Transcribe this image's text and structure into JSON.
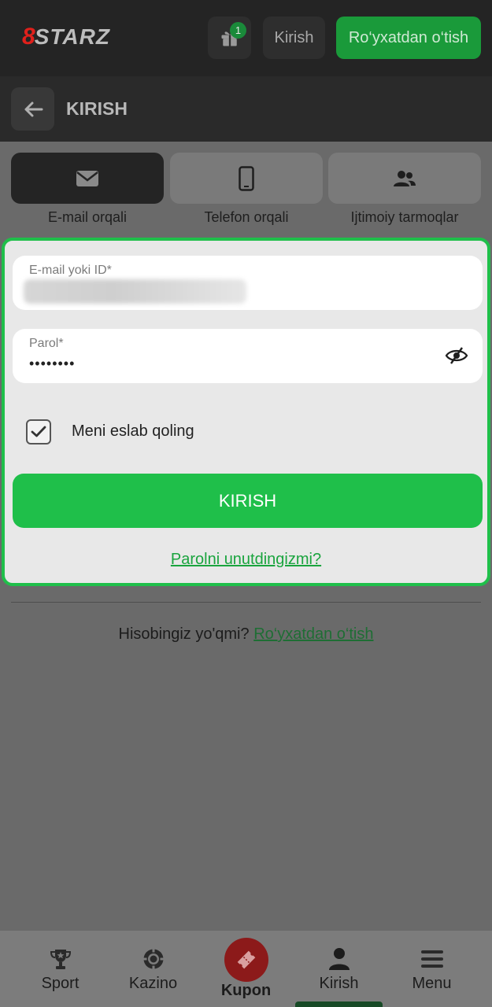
{
  "header": {
    "logo_mark": "8",
    "logo_text": "STARZ",
    "gift_badge": "1",
    "login_label": "Kirish",
    "register_label": "Ro‘yxatdan o‘tish"
  },
  "subheader": {
    "title": "KIRISH"
  },
  "tabs": [
    {
      "label": "E-mail orqali",
      "icon": "envelope-icon",
      "active": true
    },
    {
      "label": "Telefon orqali",
      "icon": "phone-icon",
      "active": false
    },
    {
      "label": "Ijtimoiy tarmoqlar",
      "icon": "people-icon",
      "active": false
    }
  ],
  "form": {
    "email_label": "E-mail yoki ID*",
    "password_label": "Parol*",
    "password_value": "••••••••",
    "remember_label": "Meni eslab qoling",
    "remember_checked": true,
    "submit_label": "KIRISH",
    "forgot_label": "Parolni unutdingizmi?"
  },
  "footer": {
    "no_account_text": "Hisobingiz yo'qmi?",
    "register_link": "Ro‘yxatdan o‘tish"
  },
  "bottom_nav": {
    "sport": "Sport",
    "kazino": "Kazino",
    "kupon": "Kupon",
    "kirish": "Kirish",
    "menu": "Menu"
  },
  "colors": {
    "accent_green": "#1fbf4a",
    "header_bg": "#242424",
    "kupon_red": "#8c1a1a"
  }
}
